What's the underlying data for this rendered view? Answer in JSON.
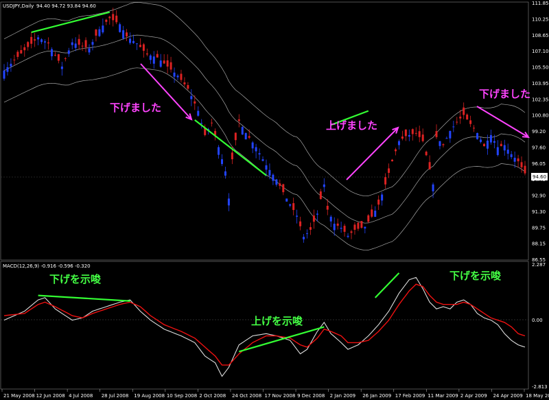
{
  "chart_data": [
    {
      "type": "candlestick",
      "title": "USDJPY,Daily",
      "ohlc_readout": "94.40 94.72 93.84 94.60",
      "current_price": "94.60",
      "ylim": [
        86.0,
        111.6
      ],
      "y_ticks": [
        "111.85",
        "110.25",
        "108.65",
        "107.10",
        "105.50",
        "103.95",
        "102.35",
        "100.80",
        "99.20",
        "97.60",
        "96.05",
        "94.45",
        "92.90",
        "91.30",
        "89.75",
        "88.15",
        "86.55"
      ],
      "x_ticks": [
        "21 May 2008",
        "12 Jun 2008",
        "4 Jul 2008",
        "28 Jul 2008",
        "19 Aug 2008",
        "10 Sep 2008",
        "2 Oct 2008",
        "24 Oct 2008",
        "17 Nov 2008",
        "9 Dec 2008",
        "2 Jan 2009",
        "26 Jan 2009",
        "17 Feb 2009",
        "11 Mar 2009",
        "2 Apr 2009",
        "24 Apr 2009",
        "18 May 2009"
      ],
      "price_path": [
        [
          0,
          104.8
        ],
        [
          5,
          106.5
        ],
        [
          10,
          108.1
        ],
        [
          13,
          107.5
        ],
        [
          17,
          105.2
        ],
        [
          20,
          107.6
        ],
        [
          25,
          107.0
        ],
        [
          28,
          108.9
        ],
        [
          31,
          110.0
        ],
        [
          34,
          109.4
        ],
        [
          36,
          108.2
        ],
        [
          39,
          107.5
        ],
        [
          42,
          106.4
        ],
        [
          45,
          106.1
        ],
        [
          48,
          105.2
        ],
        [
          51,
          104.3
        ],
        [
          54,
          103.0
        ],
        [
          57,
          100.8
        ],
        [
          59,
          98.4
        ],
        [
          61,
          99.6
        ],
        [
          63,
          97.2
        ],
        [
          65,
          94.8
        ],
        [
          66,
          92.1
        ],
        [
          67,
          96.0
        ],
        [
          69,
          99.8
        ],
        [
          71,
          98.6
        ],
        [
          74,
          97.2
        ],
        [
          77,
          95.4
        ],
        [
          80,
          94.0
        ],
        [
          83,
          92.1
        ],
        [
          86,
          90.4
        ],
        [
          88,
          88.3
        ],
        [
          90,
          89.0
        ],
        [
          92,
          90.6
        ],
        [
          94,
          93.5
        ],
        [
          95,
          91.0
        ],
        [
          97,
          89.6
        ],
        [
          99,
          89.2
        ],
        [
          101,
          88.4
        ],
        [
          103,
          89.0
        ],
        [
          106,
          89.3
        ],
        [
          108,
          90.3
        ],
        [
          110,
          91.5
        ],
        [
          112,
          93.5
        ],
        [
          114,
          95.8
        ],
        [
          116,
          97.8
        ],
        [
          118,
          98.3
        ],
        [
          121,
          98.6
        ],
        [
          123,
          97.8
        ],
        [
          125,
          95.0
        ],
        [
          126,
          93.5
        ],
        [
          127,
          98.2
        ],
        [
          129,
          97.4
        ],
        [
          131,
          98.8
        ],
        [
          133,
          99.7
        ],
        [
          135,
          100.4
        ],
        [
          137,
          99.5
        ],
        [
          139,
          98.6
        ],
        [
          141,
          97.3
        ],
        [
          143,
          98.4
        ],
        [
          145,
          97.2
        ],
        [
          147,
          97.4
        ],
        [
          149,
          96.5
        ],
        [
          151,
          95.8
        ],
        [
          153,
          94.6
        ]
      ],
      "bollinger_width_pct": 3.0,
      "indicator": {
        "label": "MACD(12,26,9) -0.916 -0.596 -0.320",
        "ylim": [
          -2.813,
          2.287
        ],
        "y_ticks": [
          "2.287",
          "0.00",
          "-2.813"
        ],
        "macd_path": [
          [
            0,
            0.1
          ],
          [
            6,
            0.5
          ],
          [
            10,
            1.0
          ],
          [
            12,
            1.1
          ],
          [
            15,
            0.6
          ],
          [
            20,
            0.1
          ],
          [
            23,
            0.2
          ],
          [
            26,
            0.5
          ],
          [
            30,
            0.7
          ],
          [
            34,
            0.9
          ],
          [
            37,
            1.0
          ],
          [
            40,
            0.5
          ],
          [
            43,
            0.1
          ],
          [
            47,
            -0.3
          ],
          [
            52,
            -0.6
          ],
          [
            56,
            -0.9
          ],
          [
            59,
            -1.5
          ],
          [
            62,
            -1.8
          ],
          [
            64,
            -2.4
          ],
          [
            66,
            -2.0
          ],
          [
            69,
            -1.0
          ],
          [
            73,
            -0.6
          ],
          [
            77,
            -0.5
          ],
          [
            80,
            -0.6
          ],
          [
            84,
            -0.8
          ],
          [
            87,
            -1.4
          ],
          [
            89,
            -1.2
          ],
          [
            92,
            -0.4
          ],
          [
            94,
            0.0
          ],
          [
            96,
            -0.5
          ],
          [
            99,
            -0.9
          ],
          [
            101,
            -1.2
          ],
          [
            104,
            -1.0
          ],
          [
            107,
            -0.6
          ],
          [
            110,
            -0.1
          ],
          [
            113,
            0.5
          ],
          [
            116,
            1.3
          ],
          [
            119,
            1.9
          ],
          [
            121,
            2.0
          ],
          [
            123,
            1.5
          ],
          [
            125,
            0.9
          ],
          [
            127,
            0.6
          ],
          [
            129,
            0.7
          ],
          [
            131,
            0.6
          ],
          [
            133,
            0.9
          ],
          [
            135,
            1.0
          ],
          [
            137,
            0.8
          ],
          [
            139,
            0.4
          ],
          [
            141,
            0.2
          ],
          [
            143,
            0.1
          ],
          [
            145,
            -0.1
          ],
          [
            147,
            -0.5
          ],
          [
            149,
            -0.8
          ],
          [
            151,
            -1.0
          ],
          [
            153,
            -1.1
          ]
        ],
        "signal_path": [
          [
            0,
            0.3
          ],
          [
            6,
            0.4
          ],
          [
            10,
            0.8
          ],
          [
            12,
            0.9
          ],
          [
            15,
            0.7
          ],
          [
            20,
            0.3
          ],
          [
            23,
            0.2
          ],
          [
            26,
            0.4
          ],
          [
            30,
            0.6
          ],
          [
            34,
            0.8
          ],
          [
            37,
            0.9
          ],
          [
            40,
            0.7
          ],
          [
            43,
            0.3
          ],
          [
            47,
            -0.1
          ],
          [
            52,
            -0.4
          ],
          [
            56,
            -0.7
          ],
          [
            59,
            -1.1
          ],
          [
            62,
            -1.5
          ],
          [
            64,
            -1.9
          ],
          [
            66,
            -1.9
          ],
          [
            69,
            -1.4
          ],
          [
            73,
            -0.9
          ],
          [
            77,
            -0.6
          ],
          [
            80,
            -0.6
          ],
          [
            84,
            -0.7
          ],
          [
            87,
            -1.0
          ],
          [
            89,
            -1.1
          ],
          [
            92,
            -0.7
          ],
          [
            94,
            -0.3
          ],
          [
            96,
            -0.4
          ],
          [
            99,
            -0.6
          ],
          [
            101,
            -0.9
          ],
          [
            104,
            -0.9
          ],
          [
            107,
            -0.8
          ],
          [
            110,
            -0.4
          ],
          [
            113,
            0.1
          ],
          [
            116,
            0.8
          ],
          [
            119,
            1.4
          ],
          [
            121,
            1.7
          ],
          [
            123,
            1.6
          ],
          [
            125,
            1.2
          ],
          [
            127,
            0.9
          ],
          [
            129,
            0.8
          ],
          [
            131,
            0.8
          ],
          [
            133,
            0.8
          ],
          [
            135,
            0.9
          ],
          [
            137,
            0.8
          ],
          [
            139,
            0.6
          ],
          [
            141,
            0.4
          ],
          [
            143,
            0.2
          ],
          [
            145,
            0.1
          ],
          [
            147,
            0.0
          ],
          [
            149,
            -0.2
          ],
          [
            151,
            -0.5
          ],
          [
            153,
            -0.6
          ]
        ]
      },
      "annotations": [
        {
          "text": "下げました",
          "color": "#ff44ff",
          "lx": "c1",
          "ly": "p1"
        },
        {
          "text": "上げました",
          "color": "#ff44ff",
          "lx": "c2",
          "ly": "p2"
        },
        {
          "text": "下げました",
          "color": "#ff44ff",
          "lx": "c3",
          "ly": "p3"
        },
        {
          "text": "下げを示唆",
          "color": "#44ff44",
          "lx": "c4",
          "ly": "p4"
        },
        {
          "text": "上げを示唆",
          "color": "#44ff44",
          "lx": "c5",
          "ly": "p5"
        },
        {
          "text": "下げを示唆",
          "color": "#44ff44",
          "lx": "c6",
          "ly": "p6"
        }
      ],
      "colors": {
        "background": "#000000",
        "up": "#2244ff",
        "down": "#dd2222",
        "bands": "#a8a8a8",
        "macd": "#dddddd",
        "signal": "#ee1111",
        "trend_price": "#33ff33",
        "trend_macd": "#33ff33",
        "arrow": "#ff44ff",
        "price_box": "#ffffff"
      }
    }
  ]
}
